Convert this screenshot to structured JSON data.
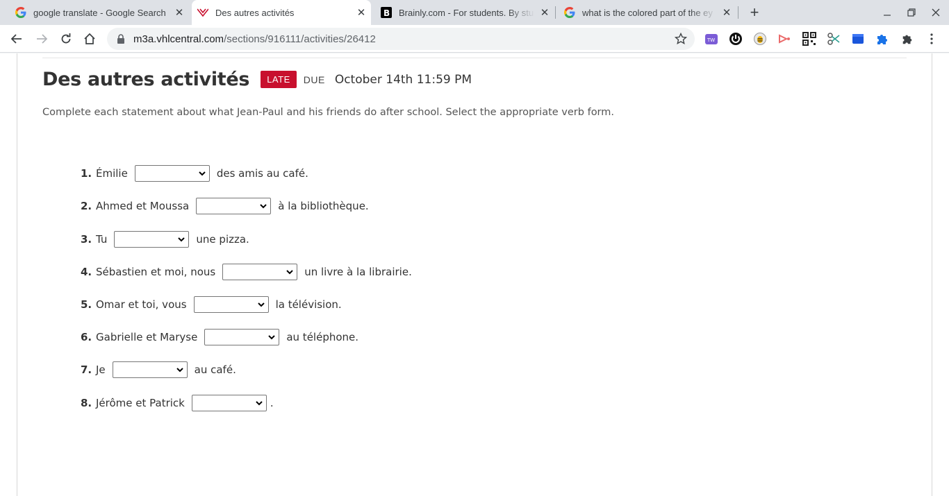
{
  "browser": {
    "tabs": [
      {
        "title": "google translate - Google Search",
        "icon": "google-icon",
        "active": false
      },
      {
        "title": "Des autres activités",
        "icon": "vhl-icon",
        "active": true
      },
      {
        "title": "Brainly.com - For students. By stu",
        "icon": "brainly-icon",
        "active": false
      },
      {
        "title": "what is the colored part of the ey",
        "icon": "google-icon",
        "active": false
      }
    ],
    "url_host": "m3a.vhlcentral.com",
    "url_path": "/sections/916111/activities/26412",
    "extensions": [
      "teamwork-icon",
      "power-icon",
      "bee-icon",
      "screencast-icon",
      "qr-code-icon",
      "scissors-icon",
      "notebook-icon",
      "puzzle-blue-icon",
      "extensions-puzzle-icon"
    ]
  },
  "activity": {
    "title": "Des autres activités",
    "badge": "LATE",
    "due_label": "DUE",
    "due_date": "October 14th 11:59 PM",
    "instructions": "Complete each statement about what Jean-Paul and his friends do after school. Select the appropriate verb form.",
    "questions": [
      {
        "num": "1.",
        "before": "Émilie",
        "after": "des amis au café."
      },
      {
        "num": "2.",
        "before": "Ahmed et Moussa",
        "after": "à la bibliothèque."
      },
      {
        "num": "3.",
        "before": "Tu",
        "after": "une pizza."
      },
      {
        "num": "4.",
        "before": "Sébastien et moi, nous",
        "after": "un livre à la librairie."
      },
      {
        "num": "5.",
        "before": "Omar et toi, vous",
        "after": "la télévision."
      },
      {
        "num": "6.",
        "before": "Gabrielle et Maryse",
        "after": "au téléphone."
      },
      {
        "num": "7.",
        "before": "Je",
        "after": "au café."
      },
      {
        "num": "8.",
        "before": "Jérôme et Patrick",
        "after": "."
      }
    ]
  },
  "colors": {
    "late_badge": "#c8102e",
    "tabstrip": "#dee1e6"
  }
}
